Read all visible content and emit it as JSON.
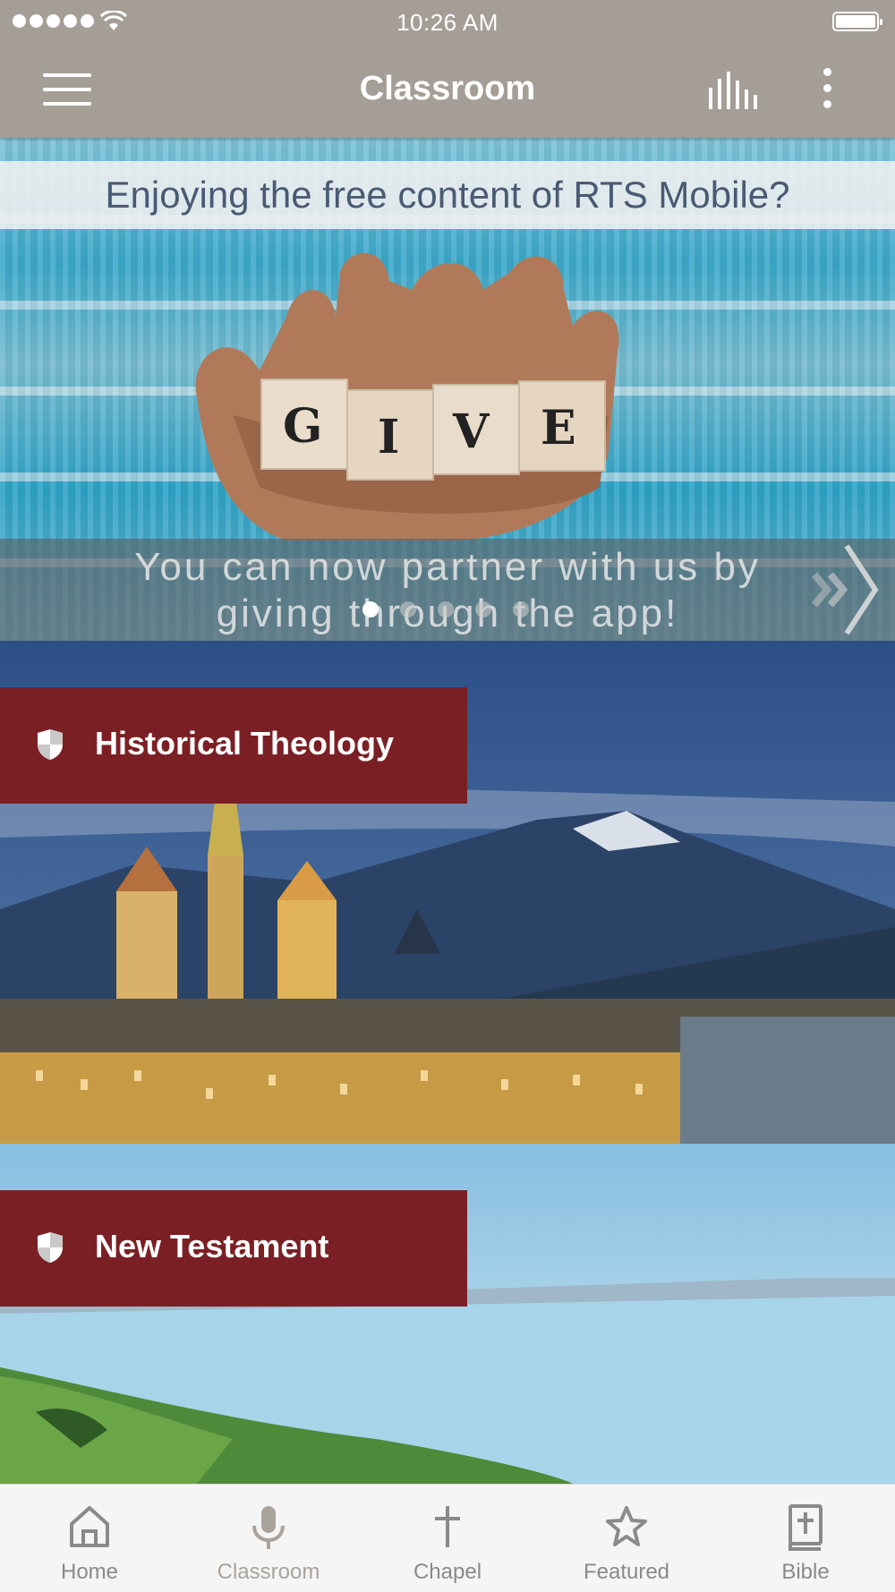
{
  "status_bar": {
    "time": "10:26 AM"
  },
  "header": {
    "title": "Classroom",
    "menu_icon": "hamburger-menu-icon",
    "stats_icon": "bar-chart-icon",
    "more_icon": "vertical-ellipsis-icon",
    "background_color": "#a59e96"
  },
  "banner": {
    "top_text": "Enjoying the free content of RTS Mobile?",
    "blocks": [
      "G",
      "I",
      "V",
      "E"
    ],
    "bottom_text_line1": "You can now partner with us by",
    "bottom_text_line2": "giving through the app!",
    "slide_count": 5,
    "active_slide": 1,
    "next_icon": "chevron-right-icon"
  },
  "courses": [
    {
      "label": "Historical Theology",
      "icon": "shield-icon"
    },
    {
      "label": "New Testament",
      "icon": "shield-icon"
    }
  ],
  "course_tag_color": "#7a2025",
  "tabbar": {
    "items": [
      {
        "label": "Home",
        "icon": "home-icon"
      },
      {
        "label": "Classroom",
        "icon": "microphone-icon",
        "active": true
      },
      {
        "label": "Chapel",
        "icon": "cross-icon"
      },
      {
        "label": "Featured",
        "icon": "star-icon"
      },
      {
        "label": "Bible",
        "icon": "bible-icon"
      }
    ]
  }
}
